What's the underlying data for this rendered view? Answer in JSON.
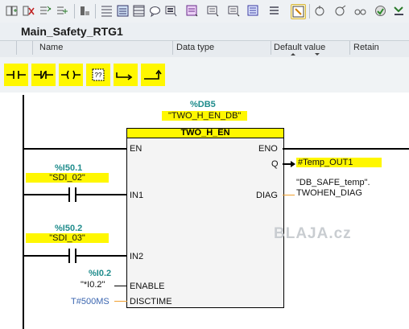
{
  "toolbar": {
    "icons": [
      "insert-network-icon",
      "delete-network-icon",
      "insert-row-icon",
      "append-row-icon",
      "go-online-icon",
      "block-interface-icon",
      "show-comments-icon",
      "networks-collapse-icon",
      "comments-icon",
      "absolute-operands-icon",
      "symbolic-operands-icon",
      "favorites-icon",
      "operand-info-icon",
      "list-icon",
      "toggle-monitor-icon",
      "download-icon",
      "upload-icon",
      "compare-icon",
      "monitor-glasses-icon"
    ]
  },
  "block": {
    "title": "Main_Safety_RTG1"
  },
  "interface": {
    "columns": [
      "Name",
      "Data type",
      "Default value",
      "Retain"
    ]
  },
  "ladbar": {
    "items": [
      "no-contact-icon",
      "nc-contact-icon",
      "coil-icon",
      "empty-box-icon",
      "open-branch-icon",
      "close-branch-icon"
    ]
  },
  "network": {
    "instance_db_address": "%DB5",
    "instance_db_name": "\"TWO_H_EN_DB\"",
    "fb_name": "TWO_H_EN",
    "pins_in": [
      "EN",
      "IN1",
      "IN2",
      "ENABLE",
      "DISCTIME"
    ],
    "pins_out": [
      "ENO",
      "Q",
      "DIAG"
    ],
    "contact1_address": "%I50.1",
    "contact1_name": "\"SDI_02\"",
    "contact2_address": "%I50.2",
    "contact2_name": "\"SDI_03\"",
    "enable_address": "%I0.2",
    "enable_name": "\"*I0.2\"",
    "disctime_value": "T#500MS",
    "q_output": "#Temp_OUT1",
    "diag_line1": "\"DB_SAFE_temp\".",
    "diag_line2": "TWOHEN_DIAG"
  },
  "watermark": "BLAJA.cz",
  "colors": {
    "highlight": "#fff700",
    "address": "#1f8c8c",
    "constant": "#3b66b0",
    "wire_orange": "#f0a030"
  }
}
